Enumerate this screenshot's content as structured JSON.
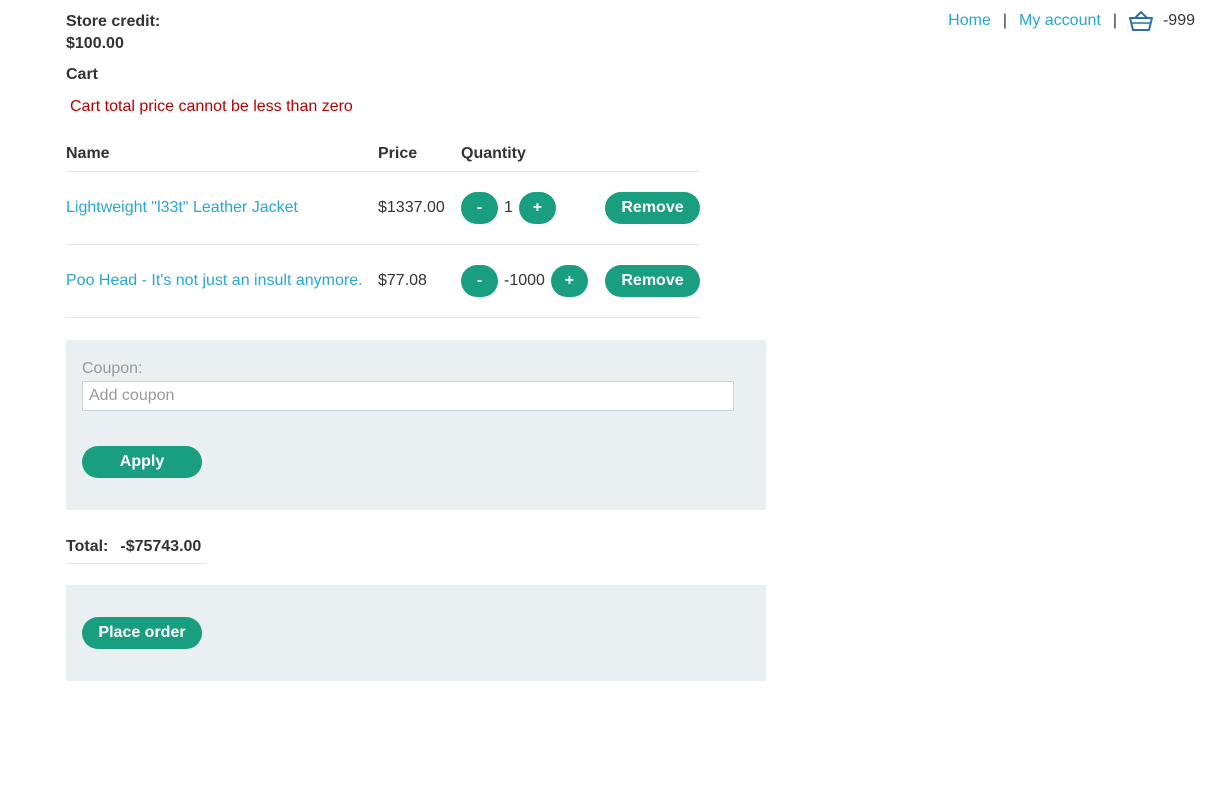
{
  "nav": {
    "home": "Home",
    "my_account": "My account",
    "separator": "|",
    "cart_count": "-999",
    "cart_icon": "basket-icon"
  },
  "store_credit": {
    "label": "Store credit:",
    "amount": "$100.00"
  },
  "cart": {
    "heading": "Cart",
    "error": "Cart total price cannot be less than zero",
    "columns": {
      "name": "Name",
      "price": "Price",
      "quantity": "Quantity"
    },
    "items": [
      {
        "name": "Lightweight \"l33t\" Leather Jacket",
        "price": "$1337.00",
        "quantity": "1",
        "minus": "-",
        "plus": "+",
        "remove": "Remove"
      },
      {
        "name": "Poo Head - It's not just an insult anymore.",
        "price": "$77.08",
        "quantity": "-1000",
        "minus": "-",
        "plus": "+",
        "remove": "Remove"
      }
    ]
  },
  "coupon": {
    "label": "Coupon:",
    "placeholder": "Add coupon",
    "apply": "Apply"
  },
  "total": {
    "label": "Total:",
    "value": "-$75743.00"
  },
  "order": {
    "place": "Place order"
  },
  "colors": {
    "accent": "#1a9e80",
    "link": "#29a5d6",
    "error": "#b50000",
    "panel": "#eaeff1"
  }
}
